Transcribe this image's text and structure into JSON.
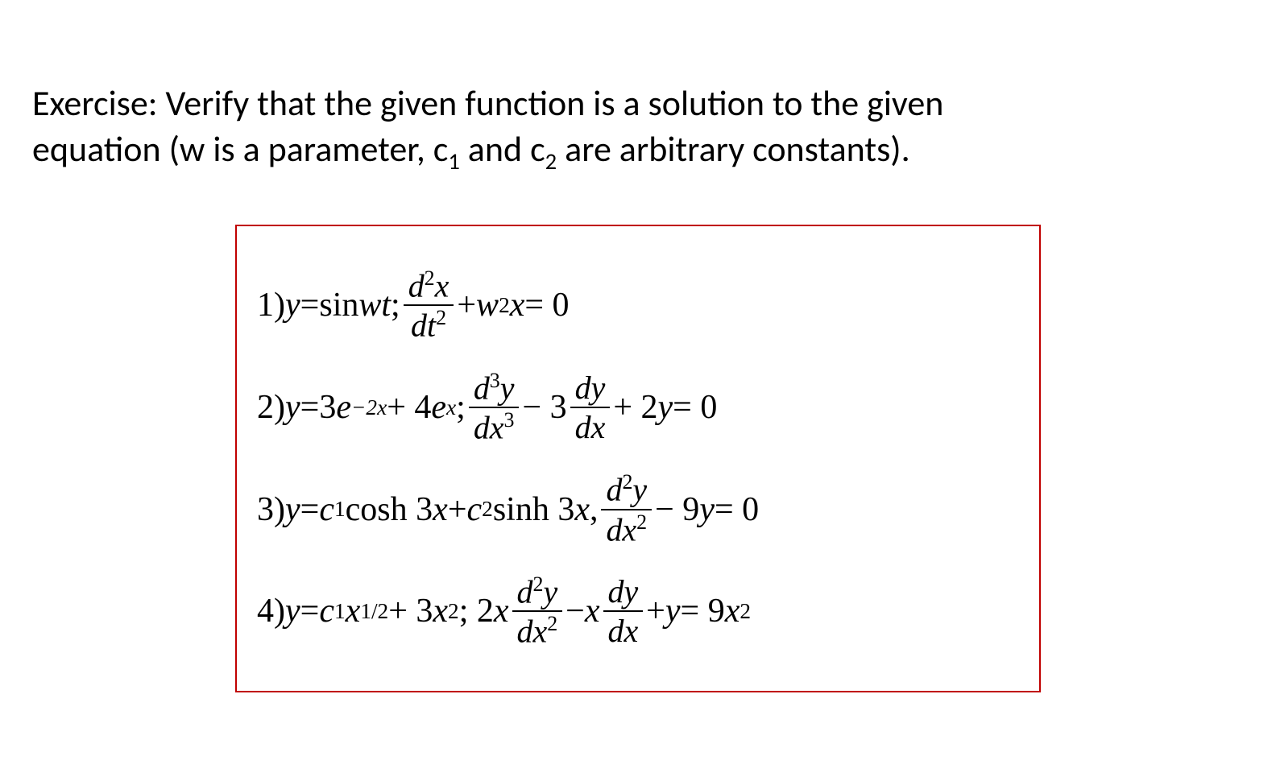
{
  "header_line1": "Exercise: Verify that the given function is a solution to the given",
  "header_line2_a": "equation (w is a parameter, c",
  "header_line2_b": " and c",
  "header_line2_c": " are arbitrary constants).",
  "sub1": "1",
  "sub2": "2",
  "problems": {
    "p1": {
      "label": "1)",
      "func_a": " y ",
      "eq": "=",
      "func_b": " sin ",
      "func_c": "wt",
      "sep": ";   ",
      "frac_top_a": "d",
      "frac_top_sup": "2",
      "frac_top_b": "x",
      "frac_bot_a": "dt",
      "frac_bot_sup": "2",
      "plus": " + ",
      "w": "w",
      "wsup": "2",
      "x": "x ",
      "zero": "= 0"
    },
    "p2": {
      "label": "2)",
      "y": " y ",
      "eq": "=",
      "three": " 3",
      "e1": "e",
      "exp1": "−2x",
      "plus1": " + 4",
      "e2": "e",
      "exp2": "x",
      "sep": ";   ",
      "f1_top_a": "d",
      "f1_top_sup": "3",
      "f1_top_b": "y",
      "f1_bot_a": "dx",
      "f1_bot_sup": "3",
      "minus3": " − 3",
      "f2_top": "dy",
      "f2_bot": "dx",
      "plus2y": " + 2",
      "yvar": "y ",
      "zero": "= 0"
    },
    "p3": {
      "label": "3)",
      "y": " y ",
      "eq": "=",
      "sp": " ",
      "c": "c",
      "s1": "1",
      "cosh": " cosh 3",
      "x1": "x",
      "plus": " + ",
      "c2": "c",
      "s2": "2",
      "sinh": " sinh 3",
      "x2": "x",
      "comma": ",   ",
      "f_top_a": "d",
      "f_top_sup": "2",
      "f_top_b": "y",
      "f_bot_a": "dx",
      "f_bot_sup": "2",
      "m9": " − 9",
      "yv": "y ",
      "zero": "= 0"
    },
    "p4": {
      "label": "4)",
      "y": " y ",
      "eq": "=",
      "sp": " ",
      "c": "c",
      "s1": "1",
      "x": "x",
      "half": "1/2",
      "plus3": " + 3",
      "x2": "x",
      "sq": "2",
      "sep": ";  2",
      "xv": "x",
      "f1_top_a": "d",
      "f1_top_sup": "2",
      "f1_top_b": "y",
      "f1_bot_a": "dx",
      "f1_bot_sup": "2",
      "mx": " − ",
      "xv2": "x",
      "f2_top": "dy",
      "f2_bot": "dx",
      "py": " + ",
      "yv": "y ",
      "eq9": "= 9",
      "xv3": "x",
      "sq2": "2"
    }
  }
}
